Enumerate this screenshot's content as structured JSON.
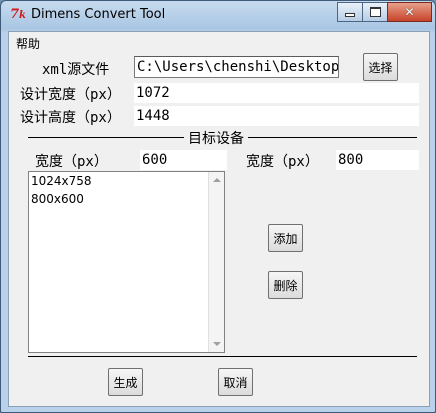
{
  "window": {
    "title": "Dimens Convert Tool",
    "icon": "tk-feather-icon"
  },
  "menu": {
    "help": "帮助"
  },
  "form": {
    "xml_label": "xml源文件",
    "xml_path": "C:\\Users\\chenshi\\Desktop\\",
    "browse_button": "选择",
    "design_width_label": "设计宽度（px）",
    "design_width": "1072",
    "design_height_label": "设计高度（px）",
    "design_height": "1448"
  },
  "target": {
    "group_title": "目标设备",
    "width1_label": "宽度（px）",
    "width1": "600",
    "width2_label": "宽度（px）",
    "width2": "800",
    "devices": [
      "1024x758",
      "800x600"
    ],
    "add_button": "添加",
    "delete_button": "删除"
  },
  "actions": {
    "generate_button": "生成",
    "cancel_button": "取消"
  }
}
